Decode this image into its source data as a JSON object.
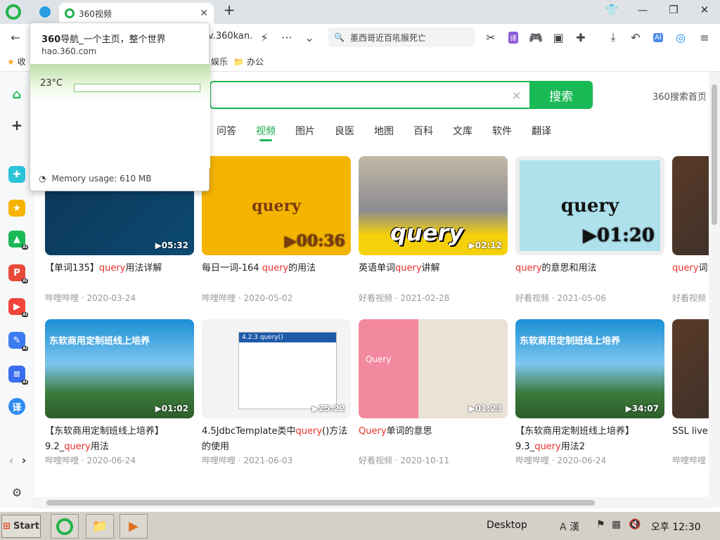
{
  "browser": {
    "tab_title": "360视频",
    "address_fragment": "v.360kan.",
    "search_placeholder": "墨西哥近百吼猴死亡",
    "bookmarks": [
      {
        "label": "收"
      },
      {
        "label": "娱乐"
      },
      {
        "label": "办公"
      }
    ]
  },
  "tooltip": {
    "title_bold": "360",
    "title_rest": "导航_一个主页，整个世界",
    "url": "hao.360.com",
    "preview_temp": "23°C",
    "memory": "Memory usage: 610 MB"
  },
  "search": {
    "button": "搜索",
    "home_link": "360搜索首页",
    "clear_icon": "×"
  },
  "nav_tabs": [
    "问答",
    "视频",
    "图片",
    "良医",
    "地图",
    "百科",
    "文库",
    "软件",
    "翻译"
  ],
  "active_tab": "视频",
  "videos_row1": [
    {
      "pre": "【单词135】",
      "hl": "query",
      "post": "用法详解",
      "meta": "哔哩哔哩 · 2020-03-24",
      "duration": "▶05:32",
      "thumb_text": ""
    },
    {
      "pre": "每日一词-164 ",
      "hl": "query",
      "post": "的用法",
      "meta": "哔哩哔哩 · 2020-05-02",
      "duration": "▶00:36",
      "thumb_text": "query"
    },
    {
      "pre": "英语单词",
      "hl": "query",
      "post": "讲解",
      "meta": "好看视频 · 2021-02-28",
      "duration": "▶02:12",
      "thumb_text": "query"
    },
    {
      "pre": "",
      "hl": "query",
      "post": "的意思和用法",
      "meta": "好看视频 · 2021-05-06",
      "duration": "▶01:20",
      "thumb_text": "query"
    },
    {
      "pre": "",
      "hl": "query",
      "post": "词...",
      "meta": "好看视频",
      "duration": "",
      "thumb_text": ""
    }
  ],
  "videos_row2": [
    {
      "line1": "【东软商用定制班线上培养】",
      "pre": "9.2_",
      "hl": "query",
      "post": "用法",
      "meta": "哔哩哔哩 · 2020-06-24",
      "duration": "▶01:02",
      "thumb_text": "东软商用定制班线上培养"
    },
    {
      "line1": "",
      "pre": "4.5JdbcTemplate类中",
      "hl": "query",
      "post": "()方法的使用",
      "meta": "哔哩哔哩 · 2021-06-03",
      "duration": "▶25:22",
      "thumb_text": "4.2.3 query()"
    },
    {
      "line1": "",
      "pre": "",
      "hl": "Query",
      "post": "单词的意思",
      "meta": "好看视频 · 2020-10-11",
      "duration": "▶01:23",
      "thumb_text": "Query"
    },
    {
      "line1": "【东软商用定制班线上培养】",
      "pre": "9.3_",
      "hl": "query",
      "post": "用法2",
      "meta": "哔哩哔哩 · 2020-06-24",
      "duration": "▶34:07",
      "thumb_text": "东软商用定制班线上培养"
    },
    {
      "line1": "",
      "pre": "SSL live",
      "hl": "",
      "post": "",
      "meta": "哔哩哔哩",
      "duration": "",
      "thumb_text": ""
    }
  ],
  "taskbar": {
    "start": "Start",
    "desktop": "Desktop",
    "ime": "A 漢",
    "clock": "오후 12:30"
  },
  "colors": {
    "accent_green": "#19b955",
    "highlight_red": "#e8312a"
  }
}
